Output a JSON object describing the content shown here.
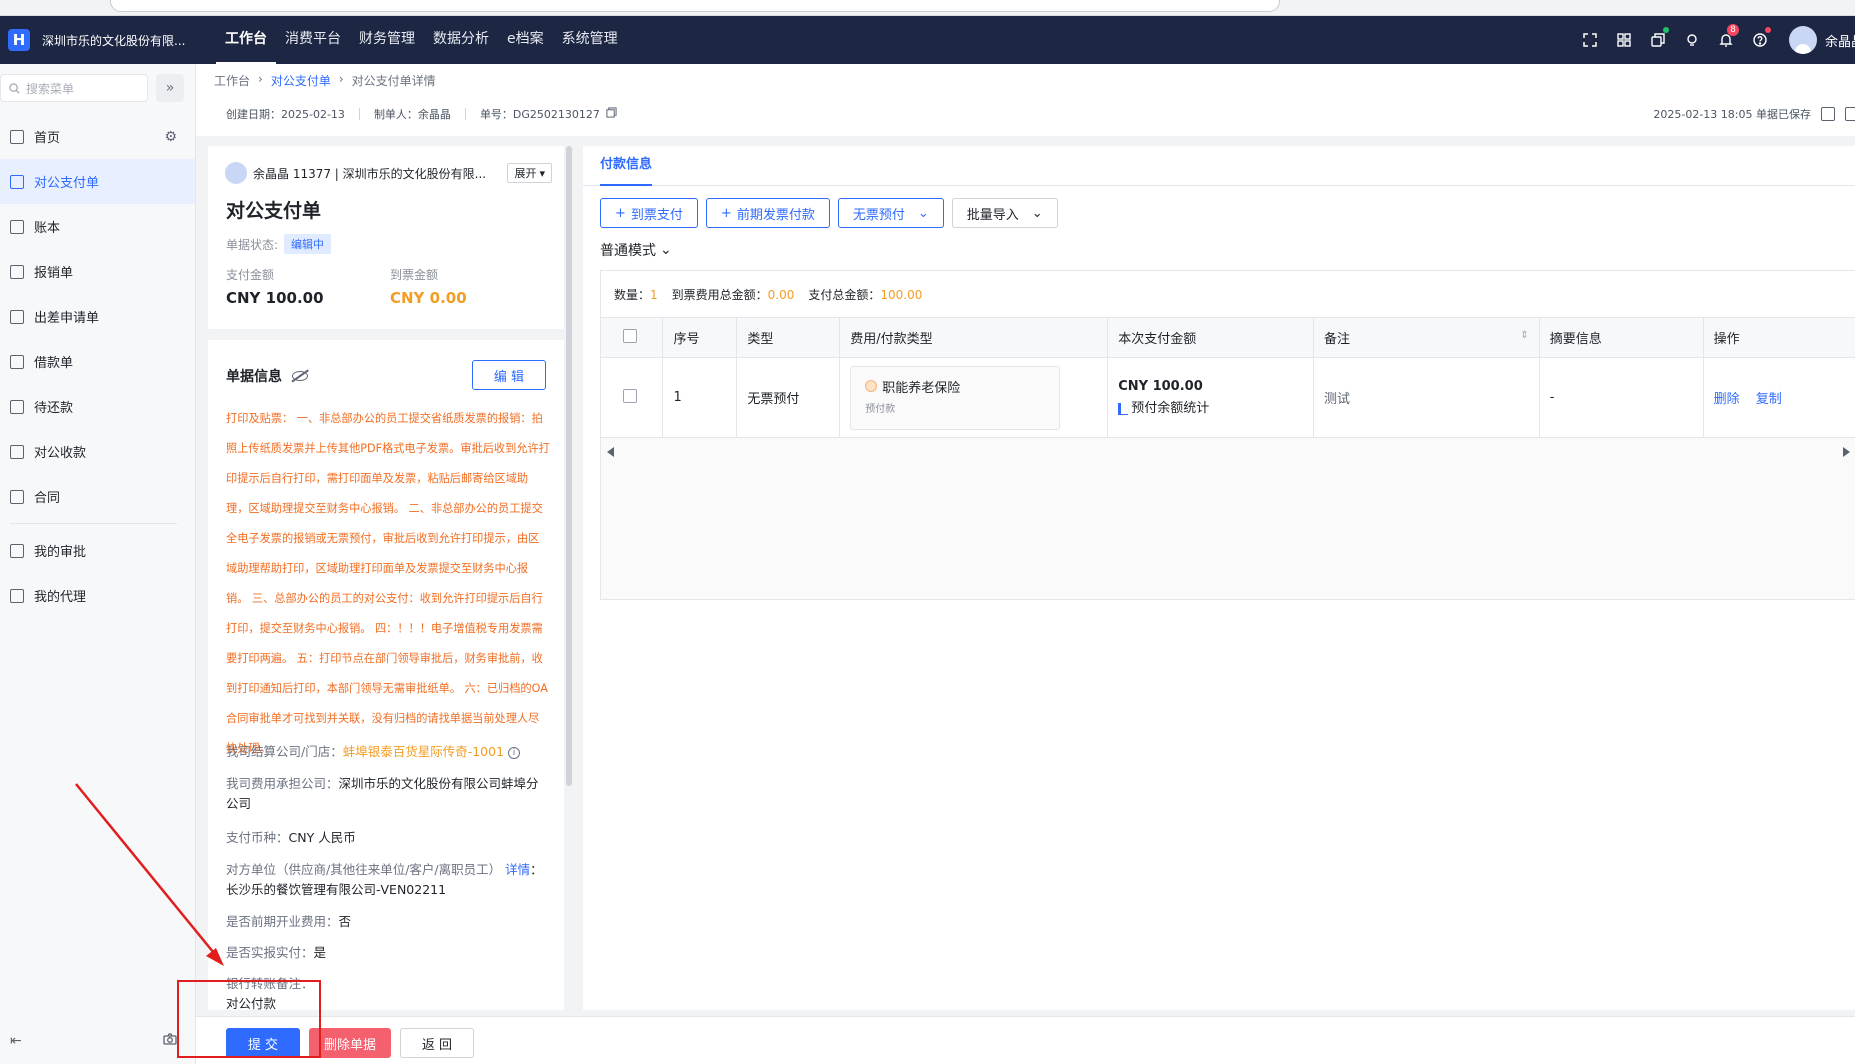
{
  "topnav": {
    "logo_glyph": "H",
    "company": "深圳市乐的文化股份有限...",
    "menu": [
      "工作台",
      "消费平台",
      "财务管理",
      "数据分析",
      "e档案",
      "系统管理"
    ],
    "active_menu": "工作台",
    "notify_badge": "8",
    "user_name": "余晶晶",
    "icons": [
      "fullscreen-icon",
      "apps-icon",
      "copy-icon",
      "lightbulb-icon",
      "bell-icon",
      "help-icon"
    ]
  },
  "sidebar": {
    "search_placeholder": "搜索菜单",
    "collapse_glyph": "»",
    "items": [
      {
        "label": "首页",
        "icon": "home-icon"
      },
      {
        "label": "对公支付单",
        "icon": "payment-icon",
        "active": true
      },
      {
        "label": "账本",
        "icon": "ledger-icon"
      },
      {
        "label": "报销单",
        "icon": "expense-icon"
      },
      {
        "label": "出差申请单",
        "icon": "travel-icon"
      },
      {
        "label": "借款单",
        "icon": "loan-icon"
      },
      {
        "label": "待还款",
        "icon": "repay-icon"
      },
      {
        "label": "对公收款",
        "icon": "receipt-icon"
      },
      {
        "label": "合同",
        "icon": "contract-icon"
      },
      {
        "label": "我的审批",
        "icon": "approval-icon"
      },
      {
        "label": "我的代理",
        "icon": "agent-icon"
      }
    ]
  },
  "breadcrumb": [
    "工作台",
    "对公支付单",
    "对公支付单详情"
  ],
  "meta": {
    "created": "创建日期：2025-02-13",
    "maker": "制单人：余晶晶",
    "doc_no": "单号：DG2502130127",
    "saved": "2025-02-13 18:05 单据已保存"
  },
  "doc_header": {
    "user_line": "余晶晶 11377 | 深圳市乐的文化股份有限...",
    "expand": "展开",
    "title": "对公支付单",
    "status_label": "单据状态:",
    "status_value": "编辑中",
    "pay_amount_label": "支付金额",
    "pay_amount": "CNY 100.00",
    "invoice_amount_label": "到票金额",
    "invoice_amount": "CNY 0.00"
  },
  "doc_info": {
    "title": "单据信息",
    "edit": "编 辑",
    "notice": "打印及贴票： 一、非总部办公的员工提交省纸质发票的报销：拍照上传纸质发票并上传其他PDF格式电子发票。审批后收到允许打印提示后自行打印，需打印面单及发票，粘贴后邮寄给区域助理，区域助理提交至财务中心报销。 二、非总部办公的员工提交全电子发票的报销或无票预付，审批后收到允许打印提示，由区域助理帮助打印，区域助理打印面单及发票提交至财务中心报销。 三、总部办公的员工的对公支付：收到允许打印提示后自行打印，提交至财务中心报销。 四：！！！电子增值税专用发票需要打印两遍。 五：打印节点在部门领导审批后，财务审批前，收到打印通知后打印，本部门领导无需审批纸单。 六：已归档的OA合同审批单才可找到并关联，没有归档的请找单据当前处理人尽快处理。",
    "settle_label": "我司结算公司/门店：",
    "settle_value": "蚌埠银泰百货星际传奇-1001",
    "cost_label": "我司费用承担公司：",
    "cost_value": "深圳市乐的文化股份有限公司蚌埠分公司",
    "currency_label": "支付币种：",
    "currency_value": "CNY 人民币",
    "counterparty_label": "对方单位（供应商/其他往来单位/客户/离职员工）",
    "counterparty_link": "详情",
    "counterparty_value": "：长沙乐的餐饮管理有限公司-VEN02211",
    "prepaid_label": "是否前期开业费用：",
    "prepaid_value": "否",
    "actual_label": "是否实报实付：",
    "actual_value": "是",
    "bank_label": "银行转账备注：",
    "bank_value": "对公付款"
  },
  "payment": {
    "tab": "付款信息",
    "buttons": [
      "到票支付",
      "前期发票付款",
      "无票预付",
      "批量导入"
    ],
    "mode": "普通模式",
    "summary_count_label": "数量：",
    "summary_count": "1",
    "summary_fee_label": "到票费用总金额：",
    "summary_fee": "0.00",
    "summary_total_label": "支付总金额：",
    "summary_total": "100.00",
    "columns": [
      "序号",
      "类型",
      "费用/付款类型",
      "本次支付金额",
      "备注",
      "摘要信息",
      "操作"
    ],
    "rows": [
      {
        "no": "1",
        "type": "无票预付",
        "fee_name": "职能养老保险",
        "fee_sub": "预付款",
        "amount": "CNY 100.00",
        "amount_link": "预付余额统计",
        "remark": "测试",
        "summary": "-",
        "actions": [
          "删除",
          "复制"
        ]
      }
    ]
  },
  "bottom": {
    "submit": "提 交",
    "delete": "删除单据",
    "back": "返 回"
  },
  "annotation_color": "#e11d1d"
}
